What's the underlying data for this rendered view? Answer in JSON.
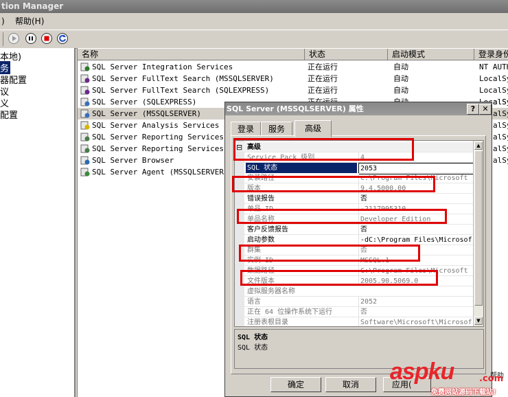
{
  "window": {
    "title": "tion Manager"
  },
  "menu": {
    "item1": ")",
    "item2": "帮助(H)"
  },
  "tree": {
    "items": [
      "本地)",
      "务",
      "器配置",
      "议",
      "义",
      "配置"
    ]
  },
  "services": {
    "columns": [
      "名称",
      "状态",
      "启动模式",
      "登录身份"
    ],
    "rows": [
      {
        "name": "SQL Server Integration Services",
        "state": "正在运行",
        "start": "自动",
        "logon": "NT AUTH",
        "icon": "gear-icon"
      },
      {
        "name": "SQL Server FullText Search (MSSQLSERVER)",
        "state": "正在运行",
        "start": "自动",
        "logon": "LocalSy",
        "icon": "abc-icon"
      },
      {
        "name": "SQL Server FullText Search (SQLEXPRESS)",
        "state": "正在运行",
        "start": "自动",
        "logon": "LocalSy",
        "icon": "abc-icon"
      },
      {
        "name": "SQL Server (SQLEXPRESS)",
        "state": "正在运行",
        "start": "自动",
        "logon": "LocalSy",
        "icon": "server-icon"
      },
      {
        "name": "SQL Server (MSSQLSERVER)",
        "state": "",
        "start": "",
        "logon": "",
        "icon": "server-icon"
      },
      {
        "name": "SQL Server Analysis Services (MS",
        "state": "",
        "start": "",
        "logon": "",
        "icon": "cube-icon"
      },
      {
        "name": "SQL Server Reporting Services (M",
        "state": "",
        "start": "",
        "logon": "",
        "icon": "report-icon"
      },
      {
        "name": "SQL Server Reporting Services (S",
        "state": "",
        "start": "",
        "logon": "",
        "icon": "report-icon"
      },
      {
        "name": "SQL Server Browser",
        "state": "",
        "start": "",
        "logon": "",
        "icon": "browser-icon"
      },
      {
        "name": "SQL Server Agent (MSSQLSERVER)",
        "state": "",
        "start": "",
        "logon": "",
        "icon": "agent-icon"
      }
    ],
    "right_edge_fragments": [
      "alSy",
      "alSy",
      "alSy",
      "alSy",
      "alSy",
      "alSy"
    ]
  },
  "dialog": {
    "title": "SQL Server (MSSQLSERVER) 属性",
    "help_glyph": "?",
    "close_glyph": "✕",
    "tabs": [
      "登录",
      "服务",
      "高级"
    ],
    "active_tab": 2,
    "section": "高级",
    "section_toggle": "⊟",
    "props": [
      {
        "k": "Service Pack 级别",
        "v": "4",
        "grey": true
      },
      {
        "k": "SQL 状态",
        "v": "2053",
        "sel": true
      },
      {
        "k": "安装路径",
        "v": "c:\\Program Files\\Microsoft",
        "grey": true
      },
      {
        "k": "版本",
        "v": "9.4.5000.00",
        "grey": true
      },
      {
        "k": "错误报告",
        "v": "否"
      },
      {
        "k": "单品 ID",
        "v": "-2117995310",
        "grey": true
      },
      {
        "k": "单品名称",
        "v": "Developer Edition",
        "grey": true
      },
      {
        "k": "客户反馈报告",
        "v": "否"
      },
      {
        "k": "启动参数",
        "v": "-dC:\\Program Files\\Microsof"
      },
      {
        "k": "群集",
        "v": "否",
        "grey": true
      },
      {
        "k": "实例 ID",
        "v": "MSSQL.1",
        "grey": true
      },
      {
        "k": "数据路径",
        "v": "C:\\Program Files\\Microsoft",
        "grey": true
      },
      {
        "k": "文件版本",
        "v": "2005.90.5069.0",
        "grey": true
      },
      {
        "k": "虚拟服务器名称",
        "v": "",
        "grey": true
      },
      {
        "k": "语言",
        "v": "2052",
        "grey": true
      },
      {
        "k": "正在 64 位操作系统下运行",
        "v": "否",
        "grey": true
      },
      {
        "k": "注册表根目录",
        "v": "Software\\Microsoft\\Microsof",
        "grey": true
      }
    ],
    "desc_title": "SQL 状态",
    "desc_text": "SQL 状态",
    "buttons": {
      "ok": "确定",
      "cancel": "取消",
      "apply": "应用("
    }
  },
  "watermark": {
    "brand": "aspku",
    "tld": ".com",
    "tagline": "免费网站源码下载站!",
    "corner": "帮助"
  },
  "colors": {
    "highlight": "#e00000",
    "selection": "#0a246a",
    "brand": "#e8252a"
  }
}
